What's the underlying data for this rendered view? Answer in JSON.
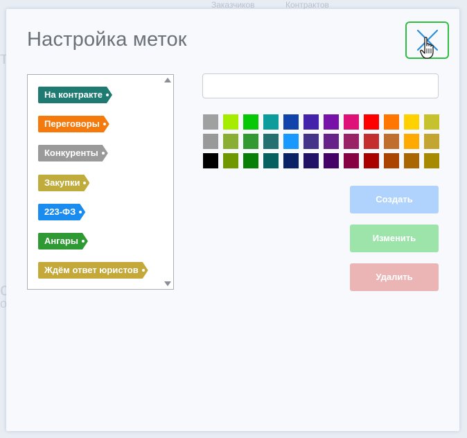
{
  "background": {
    "tabs": [
      "Заказчиков",
      "Контрактов"
    ],
    "fragments": [
      "т",
      "с",
      "о"
    ]
  },
  "dialog": {
    "title": "Настройка меток",
    "close_icon": "close-x-icon",
    "cursor_icon": "hand-pointer-icon"
  },
  "tags": [
    {
      "label": "На контракте",
      "color": "#1f7a72"
    },
    {
      "label": "Переговоры",
      "color": "#f57a0d"
    },
    {
      "label": "Конкуренты",
      "color": "#9a9a9a"
    },
    {
      "label": "Закупки",
      "color": "#c0ac3d"
    },
    {
      "label": "223-ФЗ",
      "color": "#1a8cf0"
    },
    {
      "label": "Ангары",
      "color": "#2f9a33"
    },
    {
      "label": "Ждём ответ юристов",
      "color": "#c4a83a"
    }
  ],
  "name_input": {
    "value": "",
    "placeholder": ""
  },
  "palette": [
    "#a0a0a0",
    "#a5ec00",
    "#07c707",
    "#0d9b9b",
    "#1144aa",
    "#4422aa",
    "#7711aa",
    "#dd1177",
    "#ff0000",
    "#ff7700",
    "#ffd100",
    "#c6c22e",
    "#999999",
    "#8aae33",
    "#339933",
    "#247070",
    "#1899ff",
    "#443388",
    "#662288",
    "#992266",
    "#c42e2e",
    "#c06e2e",
    "#ffaa00",
    "#c2a631",
    "#000000",
    "#6f9700",
    "#088008",
    "#076060",
    "#0c2266",
    "#221166",
    "#440066",
    "#880044",
    "#aa0000",
    "#aa4400",
    "#aa6600",
    "#a88a00"
  ],
  "buttons": {
    "create": {
      "label": "Создать",
      "color": "#b0d3fe"
    },
    "edit": {
      "label": "Изменить",
      "color": "#9de4aa"
    },
    "delete": {
      "label": "Удалить",
      "color": "#ecb5b5"
    }
  }
}
